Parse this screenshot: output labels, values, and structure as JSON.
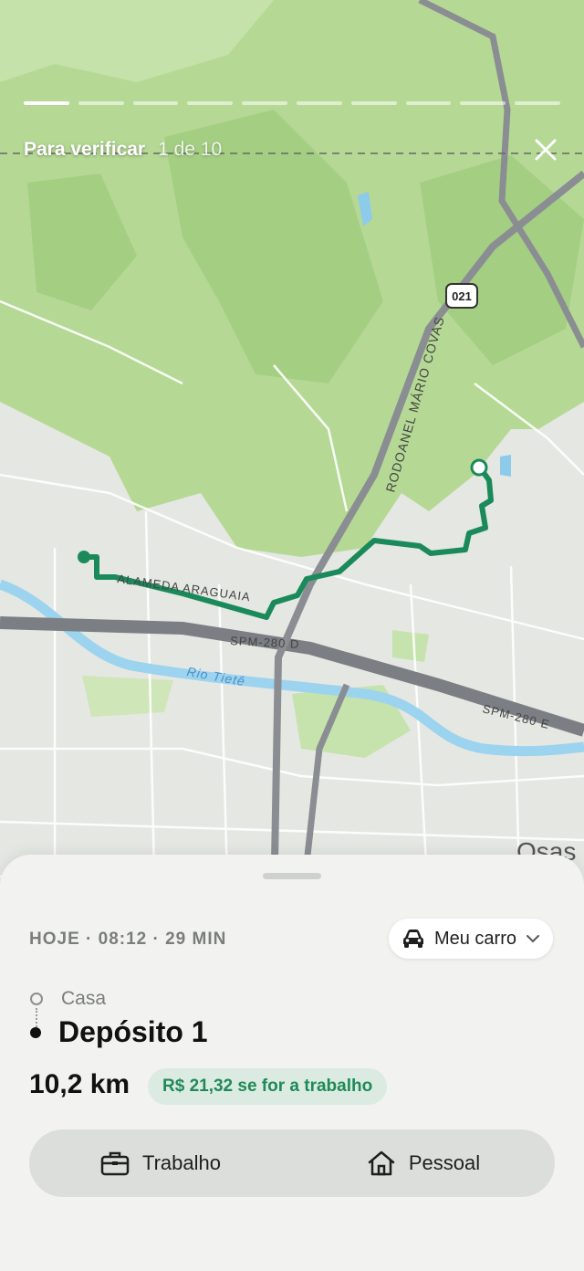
{
  "header": {
    "title": "Para verificar",
    "counter": "1 de 10",
    "progress": {
      "total": 10,
      "current": 1
    },
    "close_icon": "close-icon"
  },
  "map": {
    "labels": {
      "highway_shield": "021",
      "road_rodoanel": "RODOANEL MÁRIO COVAS",
      "road_alameda": "ALAMEDA ARAGUAIA",
      "road_spm_d": "SPM-280 D",
      "road_spm_e": "SPM-280 E",
      "river": "Rio Tietê",
      "city": "Osas"
    },
    "colors": {
      "route": "#1b8a5a",
      "forest": "#b9dc9a",
      "urban": "#e4e6e2",
      "highway": "#7b7f84",
      "river": "#9cd3ee"
    }
  },
  "trip": {
    "meta": "HOJE · 08:12 · 29 MIN",
    "vehicle_label": "Meu carro",
    "vehicle_icon": "car-icon",
    "origin": "Casa",
    "destination": "Depósito 1",
    "distance": "10,2 km",
    "reimbursement": "R$ 21,32 se for a trabalho",
    "accent": "#1f8a57"
  },
  "actions": {
    "work_label": "Trabalho",
    "work_icon": "briefcase-icon",
    "personal_label": "Pessoal",
    "personal_icon": "house-icon"
  }
}
